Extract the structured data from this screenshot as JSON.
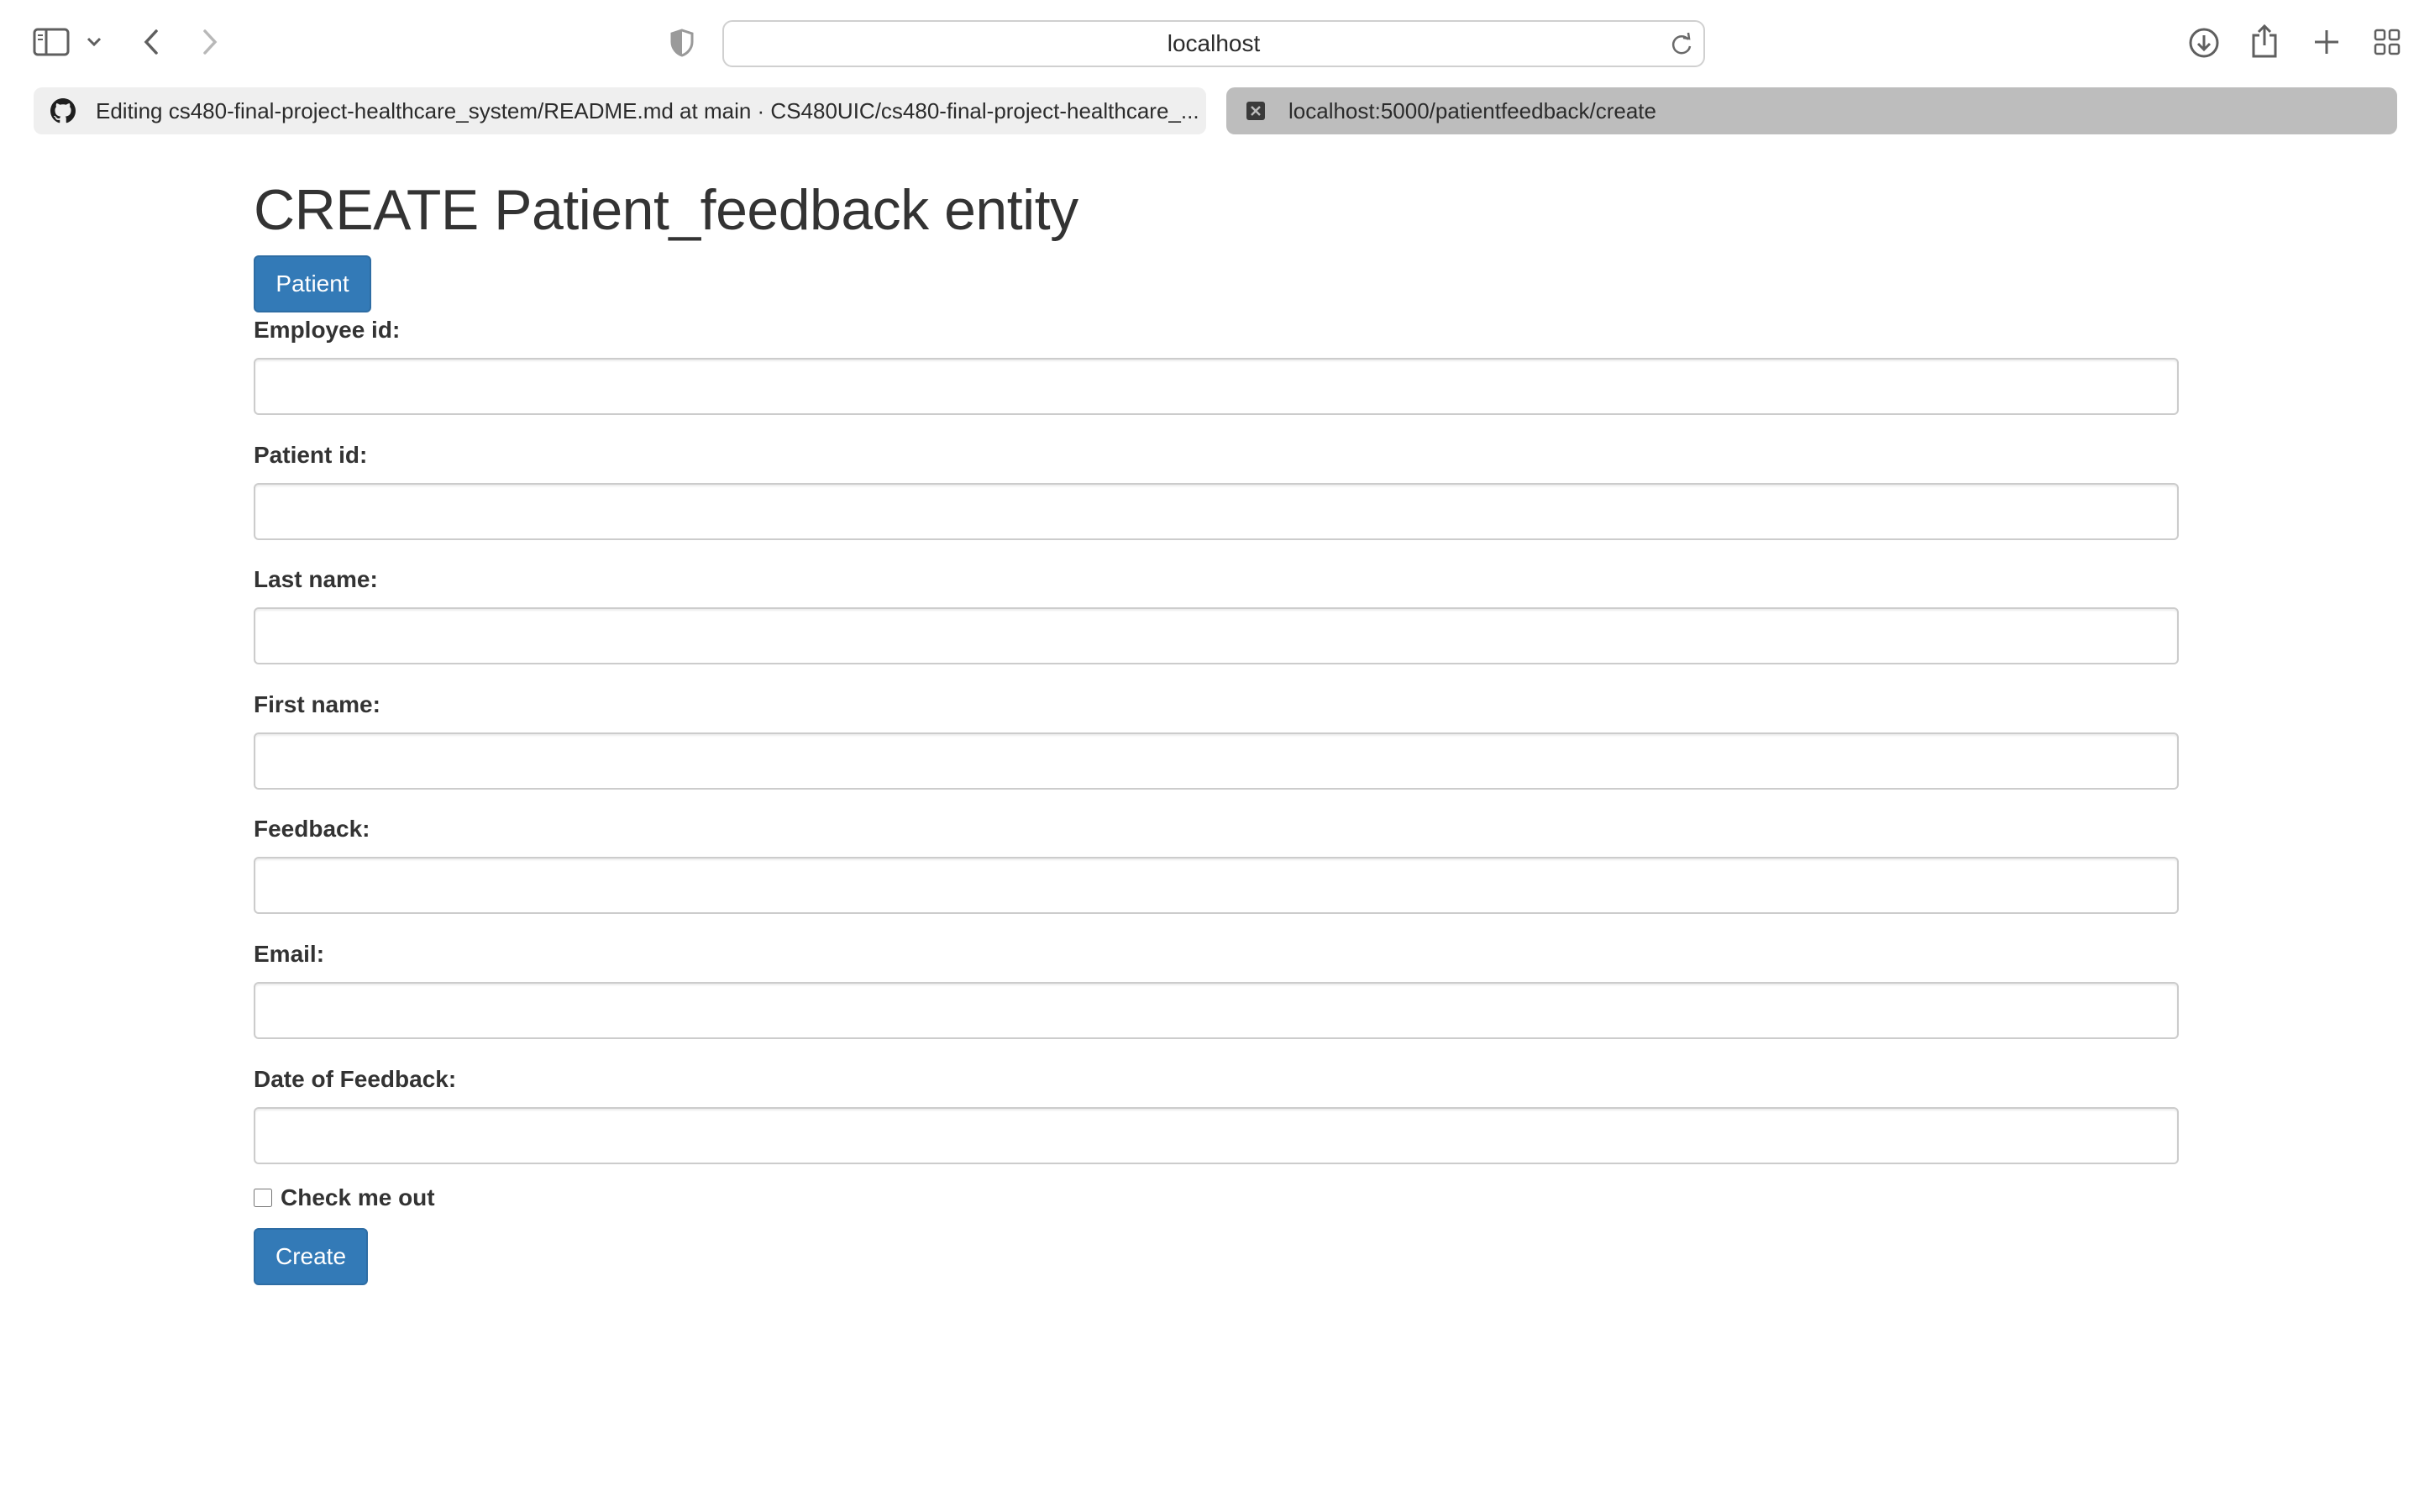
{
  "browser": {
    "address": "localhost",
    "tabs": [
      {
        "title": "Editing cs480-final-project-healthcare_system/README.md at main · CS480UIC/cs480-final-project-healthcare_...",
        "icon": "github-icon",
        "active": false
      },
      {
        "title": "localhost:5000/patientfeedback/create",
        "icon": "site-favicon-icon",
        "active": true
      }
    ]
  },
  "page": {
    "title": "CREATE Patient_feedback entity",
    "patient_button": "Patient",
    "fields": [
      {
        "label": "Employee id:",
        "value": ""
      },
      {
        "label": "Patient id:",
        "value": ""
      },
      {
        "label": "Last name:",
        "value": ""
      },
      {
        "label": "First name:",
        "value": ""
      },
      {
        "label": "Feedback:",
        "value": ""
      },
      {
        "label": "Email:",
        "value": ""
      },
      {
        "label": "Date of Feedback:",
        "value": ""
      }
    ],
    "checkbox_label": "Check me out",
    "create_button": "Create"
  },
  "colors": {
    "primary_button": "#337ab7",
    "active_tab": "#bdbdbd",
    "inactive_tab": "#efefef"
  }
}
